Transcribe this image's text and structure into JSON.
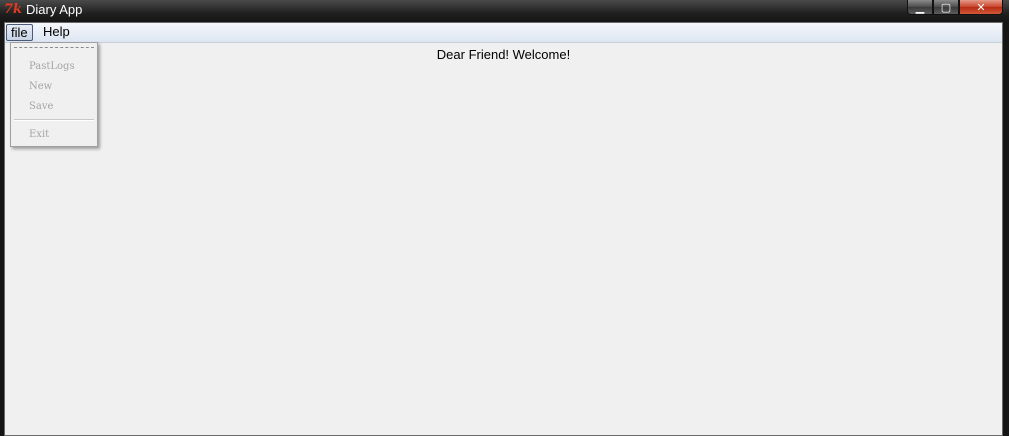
{
  "window": {
    "title": "Diary App",
    "icon": "tk-feather-icon",
    "controls": {
      "minimize": "▁",
      "maximize": "▢",
      "close": "✕"
    }
  },
  "menubar": {
    "items": [
      {
        "label": "file"
      },
      {
        "label": "Help"
      }
    ]
  },
  "file_menu": {
    "items": [
      {
        "label": "PastLogs",
        "enabled": false
      },
      {
        "label": "New",
        "enabled": false
      },
      {
        "label": "Save",
        "enabled": false
      },
      {
        "label": "Exit",
        "enabled": false
      }
    ]
  },
  "main": {
    "welcome_text": "Dear Friend! Welcome!"
  }
}
